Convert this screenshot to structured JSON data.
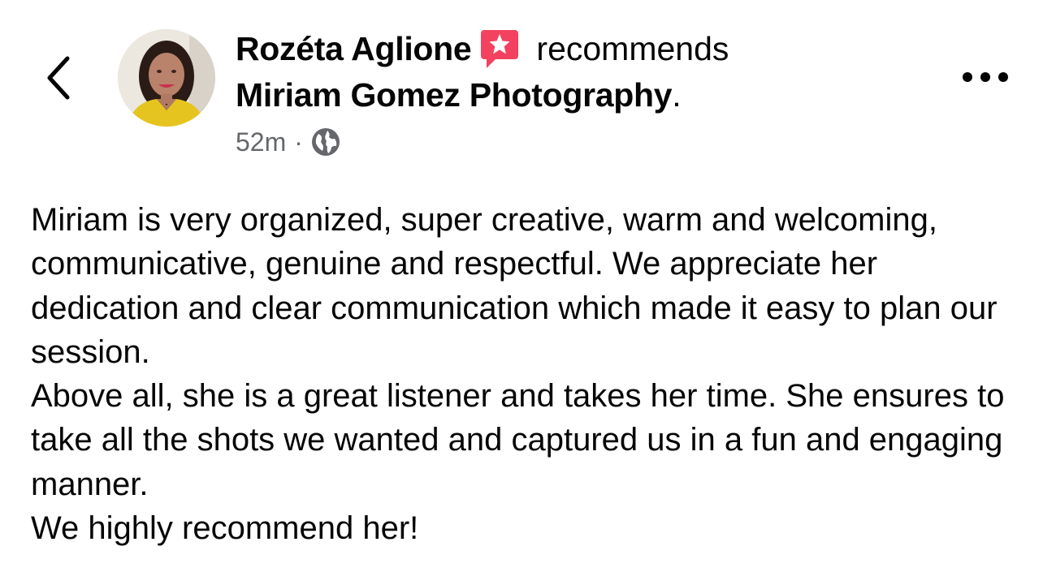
{
  "header": {
    "author_name": "Rozéta Aglione",
    "action_text": "recommends",
    "page_name": "Miriam Gomez Photography",
    "page_name_suffix": ".",
    "timestamp": "52m",
    "separator": "·",
    "privacy_icon": "globe-icon",
    "recommend_icon": "recommendation-star-icon",
    "back_icon": "chevron-left-icon",
    "more_icon": "more-horizontal-icon"
  },
  "post": {
    "paragraphs": [
      "Miriam is very organized, super creative, warm and welcoming, communicative, genuine and respectful. We appreciate her dedication and clear communication which made it easy to plan our session.",
      "Above all, she is a great listener and takes her time. She ensures to take all the shots we wanted and captured us in a fun and engaging manner.",
      "We highly recommend her!"
    ]
  },
  "colors": {
    "text_primary": "#050505",
    "text_secondary": "#65676b",
    "recommend_badge": "#f3425f",
    "background": "#ffffff"
  }
}
